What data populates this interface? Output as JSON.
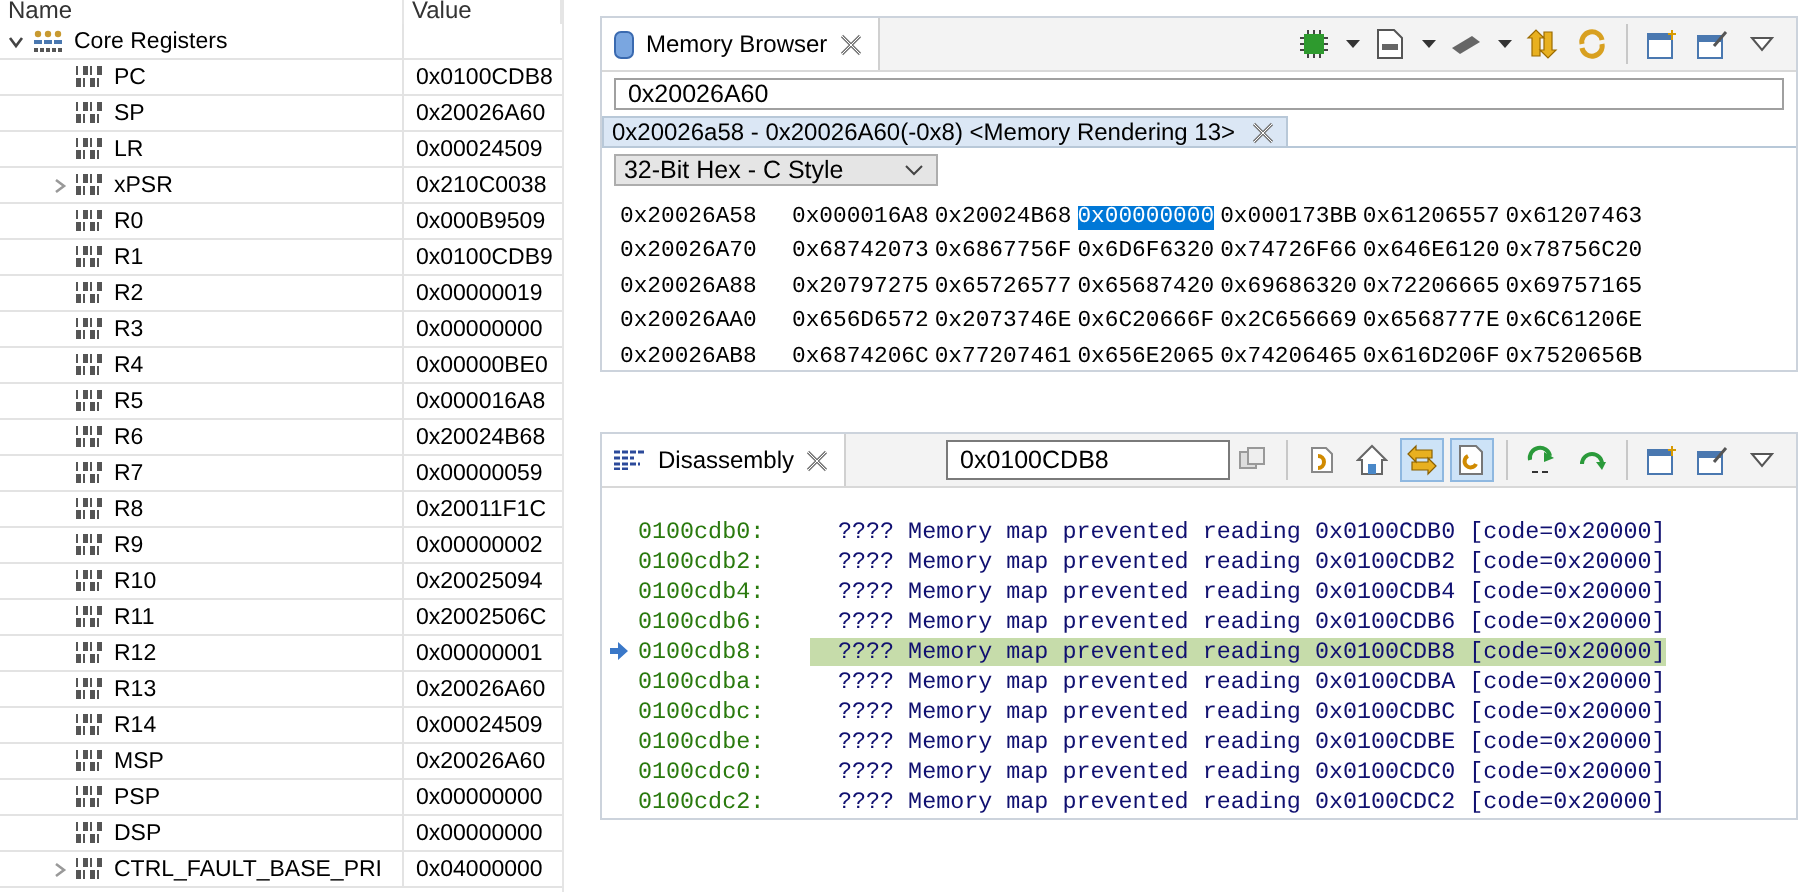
{
  "registers": {
    "columns": [
      "Name",
      "Value"
    ],
    "group": {
      "label": "Core Registers",
      "expanded": true
    },
    "rows": [
      {
        "name": "PC",
        "value": "0x0100CDB8",
        "expandable": false
      },
      {
        "name": "SP",
        "value": "0x20026A60",
        "expandable": false
      },
      {
        "name": "LR",
        "value": "0x00024509",
        "expandable": false
      },
      {
        "name": "xPSR",
        "value": "0x210C0038",
        "expandable": true
      },
      {
        "name": "R0",
        "value": "0x000B9509",
        "expandable": false
      },
      {
        "name": "R1",
        "value": "0x0100CDB9",
        "expandable": false
      },
      {
        "name": "R2",
        "value": "0x00000019",
        "expandable": false
      },
      {
        "name": "R3",
        "value": "0x00000000",
        "expandable": false
      },
      {
        "name": "R4",
        "value": "0x00000BE0",
        "expandable": false
      },
      {
        "name": "R5",
        "value": "0x000016A8",
        "expandable": false
      },
      {
        "name": "R6",
        "value": "0x20024B68",
        "expandable": false
      },
      {
        "name": "R7",
        "value": "0x00000059",
        "expandable": false
      },
      {
        "name": "R8",
        "value": "0x20011F1C",
        "expandable": false
      },
      {
        "name": "R9",
        "value": "0x00000002",
        "expandable": false
      },
      {
        "name": "R10",
        "value": "0x20025094",
        "expandable": false
      },
      {
        "name": "R11",
        "value": "0x2002506C",
        "expandable": false
      },
      {
        "name": "R12",
        "value": "0x00000001",
        "expandable": false
      },
      {
        "name": "R13",
        "value": "0x20026A60",
        "expandable": false
      },
      {
        "name": "R14",
        "value": "0x00024509",
        "expandable": false
      },
      {
        "name": "MSP",
        "value": "0x20026A60",
        "expandable": false
      },
      {
        "name": "PSP",
        "value": "0x00000000",
        "expandable": false
      },
      {
        "name": "DSP",
        "value": "0x00000000",
        "expandable": false
      },
      {
        "name": "CTRL_FAULT_BASE_PRI",
        "value": "0x04000000",
        "expandable": true
      }
    ]
  },
  "memory_browser": {
    "tab": {
      "label": "Memory Browser",
      "selected": true
    },
    "toolbar": [
      {
        "kind": "chip-green",
        "on": false
      },
      {
        "kind": "caret"
      },
      {
        "kind": "document",
        "on": false
      },
      {
        "kind": "caret"
      },
      {
        "kind": "chip-grey",
        "on": false
      },
      {
        "kind": "caret"
      },
      {
        "kind": "swap",
        "on": false
      },
      {
        "kind": "refresh",
        "on": false
      },
      {
        "kind": "separator"
      },
      {
        "kind": "new-view",
        "on": false
      },
      {
        "kind": "pin",
        "on": false
      },
      {
        "kind": "view-menu",
        "on": false
      }
    ],
    "address": "0x20026A60",
    "rendering_tab": {
      "label": "0x20026a58 - 0x20026A60(-0x8) <Memory Rendering 13>",
      "selected": true
    },
    "format": "32-Bit Hex - C Style",
    "rows": [
      {
        "address": "0x20026A58",
        "words": [
          {
            "value": "0x000016A8",
            "selected": false
          },
          {
            "value": "0x20024B68",
            "selected": false
          },
          {
            "value": "0x00000000",
            "selected": true
          },
          {
            "value": "0x000173BB",
            "selected": false
          },
          {
            "value": "0x61206557",
            "selected": false
          },
          {
            "value": "0x61207463",
            "selected": false
          }
        ]
      },
      {
        "address": "0x20026A70",
        "words": [
          {
            "value": "0x68742073",
            "selected": false
          },
          {
            "value": "0x6867756F",
            "selected": false
          },
          {
            "value": "0x6D6F6320",
            "selected": false
          },
          {
            "value": "0x74726F66",
            "selected": false
          },
          {
            "value": "0x646E6120",
            "selected": false
          },
          {
            "value": "0x78756C20",
            "selected": false
          }
        ]
      },
      {
        "address": "0x20026A88",
        "words": [
          {
            "value": "0x20797275",
            "selected": false
          },
          {
            "value": "0x65726577",
            "selected": false
          },
          {
            "value": "0x65687420",
            "selected": false
          },
          {
            "value": "0x69686320",
            "selected": false
          },
          {
            "value": "0x72206665",
            "selected": false
          },
          {
            "value": "0x69757165",
            "selected": false
          }
        ]
      },
      {
        "address": "0x20026AA0",
        "words": [
          {
            "value": "0x656D6572",
            "selected": false
          },
          {
            "value": "0x2073746E",
            "selected": false
          },
          {
            "value": "0x6C20666F",
            "selected": false
          },
          {
            "value": "0x2C656669",
            "selected": false
          },
          {
            "value": "0x6568777E",
            "selected": false
          },
          {
            "value": "0x6C61206E",
            "selected": false
          }
        ]
      },
      {
        "address": "0x20026AB8",
        "words": [
          {
            "value": "0x6874206C",
            "selected": false
          },
          {
            "value": "0x77207461",
            "selected": false
          },
          {
            "value": "0x656E2065",
            "selected": false
          },
          {
            "value": "0x74206465",
            "selected": false
          },
          {
            "value": "0x616D206F",
            "selected": false
          },
          {
            "value": "0x7520656B",
            "selected": false
          }
        ]
      }
    ]
  },
  "disassembly": {
    "tab": {
      "label": "Disassembly",
      "selected": true
    },
    "address": "0x0100CDB8",
    "toolbar": [
      {
        "kind": "goto",
        "on": false
      },
      {
        "kind": "separator"
      },
      {
        "kind": "sync",
        "on": false
      },
      {
        "kind": "home",
        "on": false
      },
      {
        "kind": "link",
        "on": true
      },
      {
        "kind": "source",
        "on": true
      },
      {
        "kind": "separator"
      },
      {
        "kind": "step-over",
        "on": false
      },
      {
        "kind": "step-return",
        "on": false
      },
      {
        "kind": "separator"
      },
      {
        "kind": "new-view",
        "on": false
      },
      {
        "kind": "pin",
        "on": false
      },
      {
        "kind": "view-menu",
        "on": false
      }
    ],
    "lines": [
      {
        "address": "0100cdb0:",
        "text": "???? Memory map prevented reading 0x0100CDB0 [code=0x20000]",
        "current": false
      },
      {
        "address": "0100cdb2:",
        "text": "???? Memory map prevented reading 0x0100CDB2 [code=0x20000]",
        "current": false
      },
      {
        "address": "0100cdb4:",
        "text": "???? Memory map prevented reading 0x0100CDB4 [code=0x20000]",
        "current": false
      },
      {
        "address": "0100cdb6:",
        "text": "???? Memory map prevented reading 0x0100CDB6 [code=0x20000]",
        "current": false
      },
      {
        "address": "0100cdb8:",
        "text": "???? Memory map prevented reading 0x0100CDB8 [code=0x20000]",
        "current": true
      },
      {
        "address": "0100cdba:",
        "text": "???? Memory map prevented reading 0x0100CDBA [code=0x20000]",
        "current": false
      },
      {
        "address": "0100cdbc:",
        "text": "???? Memory map prevented reading 0x0100CDBC [code=0x20000]",
        "current": false
      },
      {
        "address": "0100cdbe:",
        "text": "???? Memory map prevented reading 0x0100CDBE [code=0x20000]",
        "current": false
      },
      {
        "address": "0100cdc0:",
        "text": "???? Memory map prevented reading 0x0100CDC0 [code=0x20000]",
        "current": false
      },
      {
        "address": "0100cdc2:",
        "text": "???? Memory map prevented reading 0x0100CDC2 [code=0x20000]",
        "current": false
      }
    ]
  }
}
